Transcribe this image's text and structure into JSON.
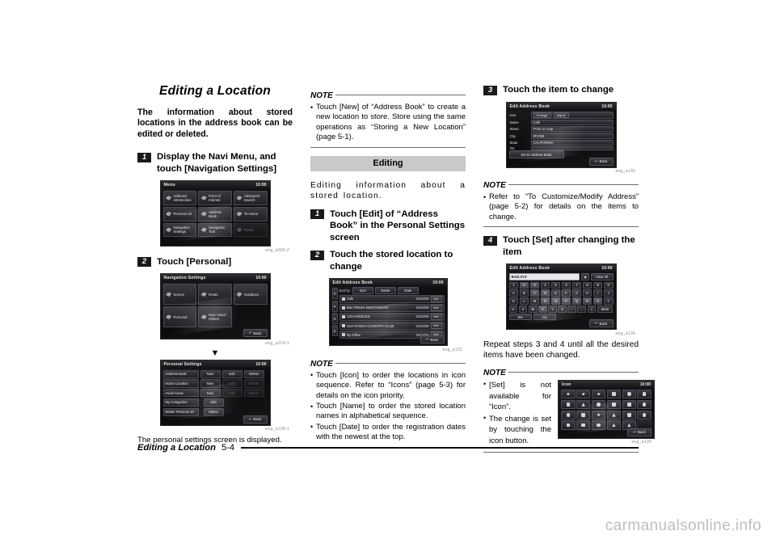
{
  "footer": {
    "title": "Editing a Location",
    "page": "5-4"
  },
  "watermark": "carmanualsonline.info",
  "col1": {
    "section_title": "Editing a Location",
    "intro": "The information about stored locations in the address book can be edited or deleted.",
    "step1": {
      "num": "1",
      "text": "Display the Navi Menu, and touch [Navigation Settings]"
    },
    "step2": {
      "num": "2",
      "text": "Touch [Personal]"
    },
    "fig_menu": {
      "caption": "eng_a500-2",
      "title": "Menu",
      "clock": "10:00",
      "buttons": [
        {
          "label": "Address/ Intersection",
          "dim": false
        },
        {
          "label": "Point of Interest",
          "dim": false
        },
        {
          "label": "Advanced Search",
          "dim": false
        },
        {
          "label": "Previous 20",
          "dim": false
        },
        {
          "label": "Address Book",
          "dim": false
        },
        {
          "label": "To Home",
          "dim": false
        },
        {
          "label": "Navigation Settings",
          "dim": false
        },
        {
          "label": "Navigation Tool",
          "dim": false
        },
        {
          "label": "Route",
          "dim": true
        }
      ]
    },
    "fig_navset": {
      "caption": "eng_a018-1",
      "title": "Navigation Settings",
      "clock": "10:00",
      "buttons": [
        {
          "label": "Screen"
        },
        {
          "label": "Route"
        },
        {
          "label": "Guidance"
        },
        {
          "label": "Personal"
        },
        {
          "label": "Navi Voice/ Others"
        }
      ],
      "back": "Back"
    },
    "fig_personal": {
      "caption": "eng_a128-1",
      "title": "Personal Settings",
      "clock": "10:00",
      "rows": [
        {
          "name": "Address Book",
          "actions": [
            {
              "label": "New",
              "off": false
            },
            {
              "label": "Edit",
              "off": false
            },
            {
              "label": "Delete",
              "off": false
            }
          ]
        },
        {
          "name": "Home Location",
          "actions": [
            {
              "label": "New",
              "off": false
            },
            {
              "label": "Edit",
              "off": true
            },
            {
              "label": "Delete",
              "off": true
            }
          ]
        },
        {
          "name": "Avoid Areas",
          "actions": [
            {
              "label": "New",
              "off": false
            },
            {
              "label": "Edit",
              "off": true
            },
            {
              "label": "Delete",
              "off": true
            }
          ]
        },
        {
          "name": "My Categories",
          "wide": {
            "label": "Edit"
          }
        },
        {
          "name": "Delete Previous 20",
          "wide": {
            "label": "Select"
          }
        }
      ],
      "back": "Back"
    },
    "caption_line": "The personal settings screen is displayed."
  },
  "col2": {
    "note1": {
      "label": "NOTE",
      "items": [
        "Touch [New] of “Address Book” to create a new location to store. Store using the same operations as “Storing a New Location” (page 5-1)."
      ]
    },
    "section_bar": "Editing",
    "lead": "Editing information about a stored location.",
    "step1": {
      "num": "1",
      "text": "Touch [Edit] of “Address Book” in the Personal Settings screen"
    },
    "step2": {
      "num": "2",
      "text": "Touch the stored location to change"
    },
    "fig_list": {
      "caption": "eng_a132",
      "title": "Edit Address Book",
      "clock": "10:00",
      "sort_label": "Sort by",
      "sort_buttons": [
        "Icon",
        "Name",
        "Date"
      ],
      "rows": [
        {
          "name": "Cafe",
          "date": "04/16/08",
          "info": "Info"
        },
        {
          "name": "B&s FRESH RESTAURANT",
          "date": "04/16/08",
          "info": "Info"
        },
        {
          "name": "LOS ANGELES",
          "date": "04/16/08",
          "info": "Info"
        },
        {
          "name": "OLD RANCH COUNTRY CLUB",
          "date": "04/16/08",
          "info": "Info"
        },
        {
          "name": "My Office",
          "date": "04/16/08",
          "info": "Info"
        }
      ],
      "back": "Back"
    },
    "note2": {
      "label": "NOTE",
      "items": [
        "Touch [Icon] to order the locations in icon sequence. Refer to “Icons” (page 5-3) for details on the icon priority.",
        "Touch [Name] to order the stored location names in alphabetical sequence.",
        "Touch [Date] to order the registration dates with the newest at the top."
      ]
    }
  },
  "col3": {
    "step3": {
      "num": "3",
      "text": "Touch the item to change"
    },
    "fig_form": {
      "caption": "eng_a130",
      "title": "Edit Address Book",
      "clock": "10:00",
      "fields": [
        {
          "label": "Icon",
          "value": "",
          "chips": [
            "Change",
            "Adjust"
          ]
        },
        {
          "label": "Name",
          "value": "Cafe",
          "chips": []
        },
        {
          "label": "Street",
          "value": "Point on map",
          "chips": []
        },
        {
          "label": "City",
          "value": "IRVINE",
          "chips": []
        },
        {
          "label": "State",
          "value": "CALIFORNIA",
          "chips": []
        },
        {
          "label": "Tel.",
          "value": "",
          "chips": []
        }
      ],
      "set_button": "Set to Address Book",
      "back": "Back"
    },
    "note3": {
      "label": "NOTE",
      "items": [
        "Refer to “To Customize/Modify Address” (page 5-2) for details on the items to change."
      ]
    },
    "step4": {
      "num": "4",
      "text": "Touch [Set] after changing the item"
    },
    "fig_keyboard": {
      "caption": "eng_a134",
      "title": "Edit Address Book",
      "clock": "10:00",
      "field_value": "BAR.XYZ",
      "backspace": "◀",
      "clear_all": "Clear All",
      "rows": [
        [
          "1",
          "2",
          "3",
          "4",
          "5",
          "6",
          "7",
          "8",
          "9",
          "0"
        ],
        [
          "A",
          "B",
          "C",
          "D",
          "E",
          "F",
          "G",
          "H",
          "I",
          "J"
        ],
        [
          "K",
          "L",
          "M",
          "N",
          "O",
          "P",
          "Q",
          "R",
          "S",
          "T"
        ],
        [
          "U",
          "V",
          "W",
          "X",
          "Y",
          "Z",
          "-",
          ".",
          "(",
          ")"
        ]
      ],
      "more": "More",
      "set": "Set",
      "case": "A/a",
      "back": "Back"
    },
    "repeat_text": "Repeat steps 3 and 4 until all the desired items have been changed.",
    "note4": {
      "label": "NOTE",
      "items": [
        "[Set] is not available for “Icon”.",
        "The change is set by touching the icon button."
      ]
    },
    "fig_icons": {
      "caption": "eng_a135",
      "title": "Icon",
      "clock": "10:00",
      "back": "Back"
    }
  }
}
